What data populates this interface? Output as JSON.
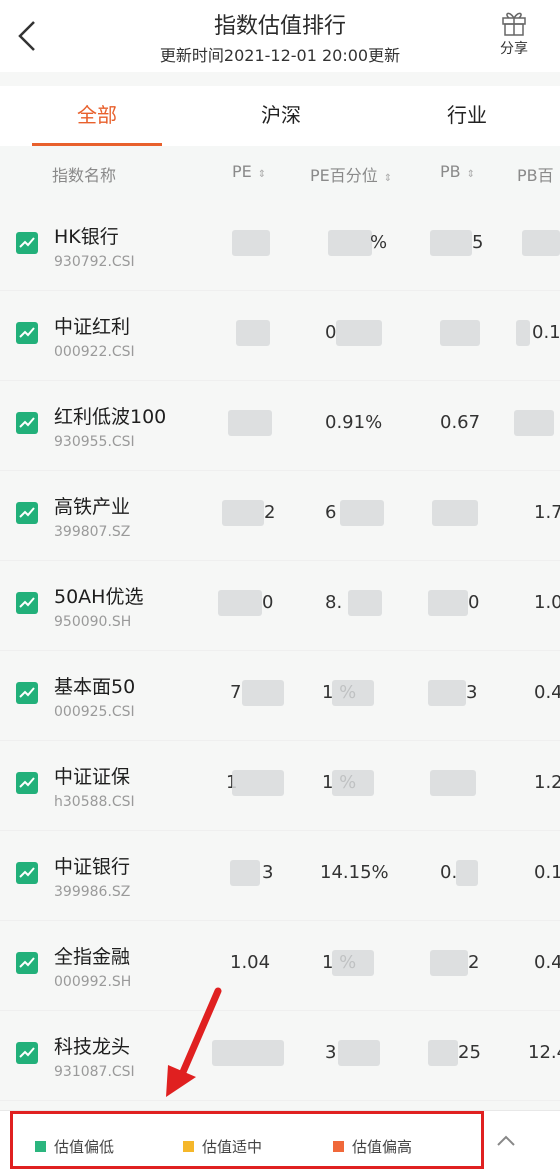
{
  "header": {
    "title": "指数估值排行",
    "update_time": "更新时间2021-12-01 20:00更新",
    "share_label": "分享"
  },
  "tabs": [
    {
      "label": "全部",
      "active": true
    },
    {
      "label": "沪深",
      "active": false
    },
    {
      "label": "行业",
      "active": false
    }
  ],
  "columns": {
    "name": "指数名称",
    "pe": "PE",
    "pe_pct": "PE百分位",
    "pb": "PB",
    "pb_pct": "PB百"
  },
  "rows": [
    {
      "name": "HK银行",
      "code": "930792.CSI",
      "pe": "",
      "pe_pct": "%",
      "pb": "5",
      "pb_pct": ""
    },
    {
      "name": "中证红利",
      "code": "000922.CSI",
      "pe": "",
      "pe_pct": "0",
      "pb": "",
      "pb_pct": "0.1"
    },
    {
      "name": "红利低波100",
      "code": "930955.CSI",
      "pe": "",
      "pe_pct": "0.91%",
      "pb": "0.67",
      "pb_pct": ""
    },
    {
      "name": "高铁产业",
      "code": "399807.SZ",
      "pe": "2",
      "pe_pct": "6",
      "pb": "",
      "pb_pct": "1.7"
    },
    {
      "name": "50AH优选",
      "code": "950090.SH",
      "pe": "0",
      "pe_pct": "8.",
      "pb": "0",
      "pb_pct": "1.0"
    },
    {
      "name": "基本面50",
      "code": "000925.CSI",
      "pe": "7",
      "pe_pct": "1 %",
      "pb": "3",
      "pb_pct": "0.4"
    },
    {
      "name": "中证证保",
      "code": "h30588.CSI",
      "pe": "1",
      "pe_pct": "1 %",
      "pb": "",
      "pb_pct": "1.2"
    },
    {
      "name": "中证银行",
      "code": "399986.SZ",
      "pe": "3",
      "pe_pct": "14.15%",
      "pb": "0.",
      "pb_pct": "0.1"
    },
    {
      "name": "全指金融",
      "code": "000992.SH",
      "pe": "1.04",
      "pe_pct": "1 %",
      "pb": "2",
      "pb_pct": "0.4"
    },
    {
      "name": "科技龙头",
      "code": "931087.CSI",
      "pe": "",
      "pe_pct": "3",
      "pb": "25",
      "pb_pct": "12.4"
    }
  ],
  "legend": [
    {
      "label": "估值偏低",
      "color": "#2bb57e"
    },
    {
      "label": "估值适中",
      "color": "#f5b72a"
    },
    {
      "label": "估值偏高",
      "color": "#f0683a"
    }
  ],
  "colors": {
    "accent": "#e8602c",
    "badge": "#22b07a",
    "annotation": "#e02020"
  }
}
